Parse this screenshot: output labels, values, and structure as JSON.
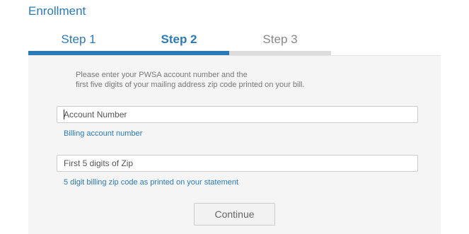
{
  "page": {
    "title": "Enrollment"
  },
  "steps": [
    {
      "label": "Step 1",
      "state": "complete"
    },
    {
      "label": "Step 2",
      "state": "active"
    },
    {
      "label": "Step 3",
      "state": "pending"
    }
  ],
  "instructions": {
    "line1": "Please enter your PWSA account number and the",
    "line2": "first five digits of your mailing address zip code printed on your bill."
  },
  "form": {
    "account": {
      "value": "",
      "placeholder": "Account Number",
      "hint": "Billing account number"
    },
    "zip": {
      "value": "",
      "placeholder": "First 5 digits of Zip",
      "hint": "5 digit billing zip code as printed on your statement"
    },
    "continue_label": "Continue"
  },
  "colors": {
    "accent": "#2a7ab8",
    "inactive_step": "#888888",
    "panel_bg": "#f5f5f5"
  }
}
